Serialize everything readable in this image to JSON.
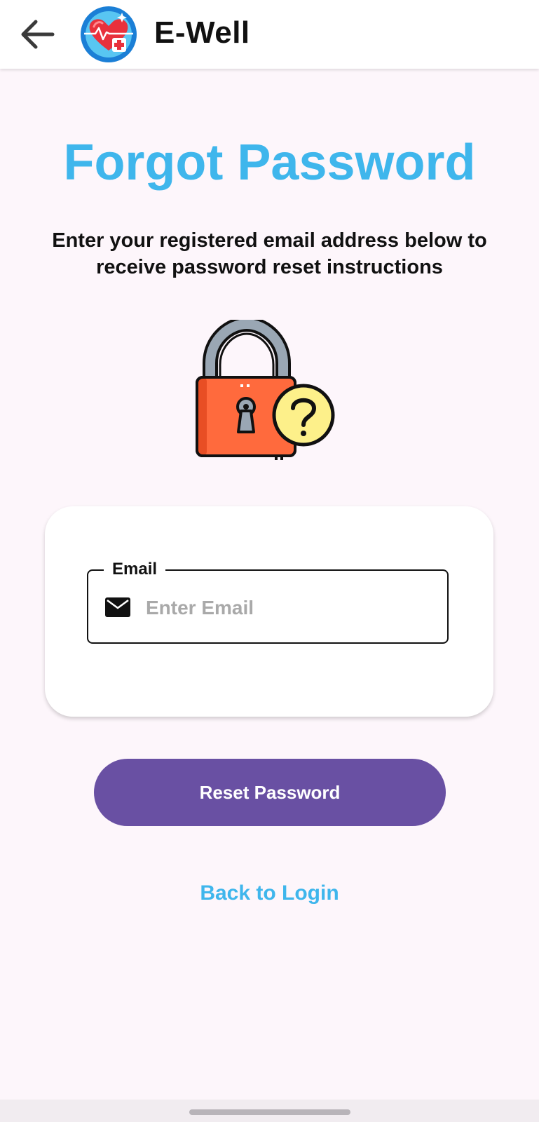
{
  "app_bar": {
    "title": "E-Well"
  },
  "page": {
    "title": "Forgot Password",
    "subtitle": "Enter your registered email address below to receive password reset instructions"
  },
  "form": {
    "email_label": "Email",
    "email_placeholder": "Enter Email",
    "email_value": ""
  },
  "actions": {
    "reset_label": "Reset Password",
    "back_to_login_label": "Back to Login"
  },
  "icons": {
    "back": "arrow-left-icon",
    "logo": "heart-health-logo",
    "illustration": "padlock-question-icon",
    "email": "mail-icon"
  },
  "colors": {
    "accent_blue": "#3fb6ec",
    "primary_purple": "#6950a3",
    "background": "#fdf6fb",
    "lock_body": "#ff6a3d",
    "question_badge": "#fdf08a"
  }
}
